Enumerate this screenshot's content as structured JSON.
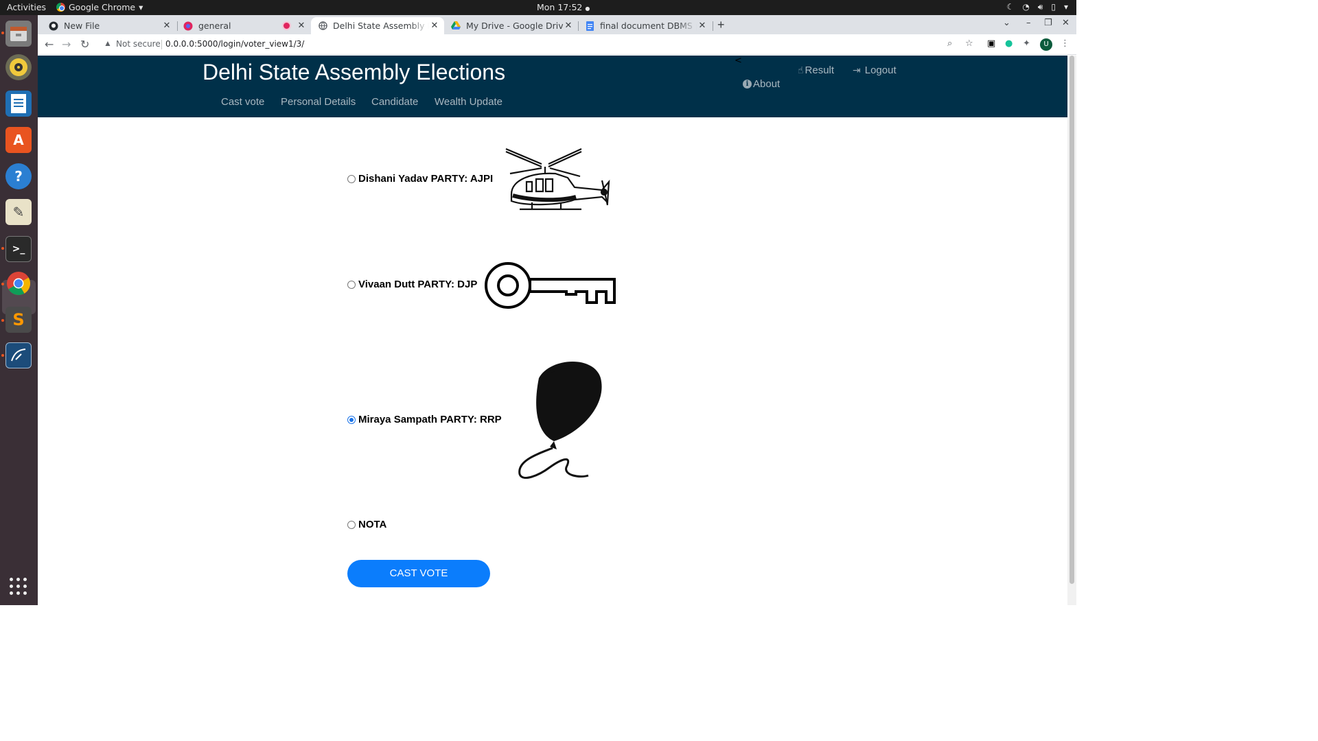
{
  "system": {
    "activities": "Activities",
    "app_name": "Google Chrome",
    "clock": "Mon 17:52"
  },
  "browser": {
    "tabs": [
      {
        "title": "New File",
        "icon": "github-icon"
      },
      {
        "title": "general",
        "icon": "discord-icon"
      },
      {
        "title": "Delhi State Assembly Elections",
        "icon": "globe-icon",
        "active": true
      },
      {
        "title": "My Drive - Google Drive",
        "icon": "drive-icon"
      },
      {
        "title": "final document DBMS project",
        "icon": "docs-icon"
      }
    ],
    "security_label": "Not secure",
    "url": "0.0.0.0:5000/login/voter_view1/3/",
    "profile_initial": "U"
  },
  "site": {
    "title": "Delhi State Assembly Elections",
    "nav": [
      "Cast vote",
      "Personal Details",
      "Candidate",
      "Wealth Update"
    ],
    "about": "About",
    "result": "Result",
    "logout": "Logout",
    "caret": "<",
    "header_color": "#003049",
    "button_color": "#0b7dfc"
  },
  "ballot": {
    "candidates": [
      {
        "label": "Dishani Yadav PARTY: AJPI",
        "symbol": "helicopter-symbol",
        "selected": false
      },
      {
        "label": "Vivaan Dutt PARTY: DJP",
        "symbol": "key-symbol",
        "selected": false
      },
      {
        "label": "Miraya Sampath PARTY: RRP",
        "symbol": "balloon-symbol",
        "selected": true
      },
      {
        "label": "NOTA",
        "selected": false
      }
    ],
    "submit_label": "CAST VOTE"
  }
}
